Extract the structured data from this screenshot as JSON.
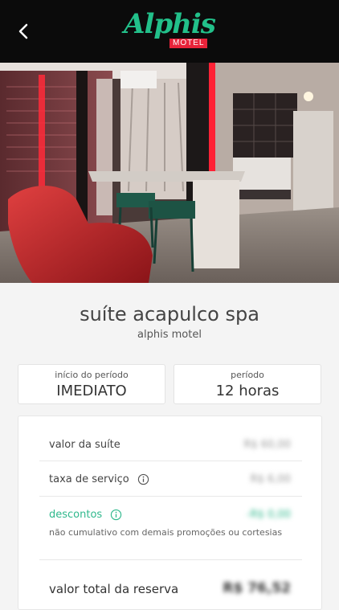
{
  "header": {
    "logo_script": "Alphis",
    "logo_badge": "MOTEL",
    "accent_color": "#22c08a",
    "badge_color": "#e8233a"
  },
  "gallery": {
    "photo_count": 12,
    "active_index": 0
  },
  "suite": {
    "name": "suíte acapulco spa",
    "motel": "alphis motel"
  },
  "period_start": {
    "label": "início do período",
    "value": "IMEDIATO"
  },
  "period": {
    "label": "período",
    "value": "12 horas"
  },
  "pricing": {
    "suite_value_label": "valor da suíte",
    "suite_value": "R$ 60,00",
    "service_fee_label": "taxa de serviço",
    "service_fee": "R$ 6,00",
    "discounts_label": "descontos",
    "discounts": "-R$ 0,00",
    "discount_note": "não cumulativo com demais promoções ou cortesias",
    "total_label": "valor total da reserva",
    "total": "R$ 76,52"
  }
}
